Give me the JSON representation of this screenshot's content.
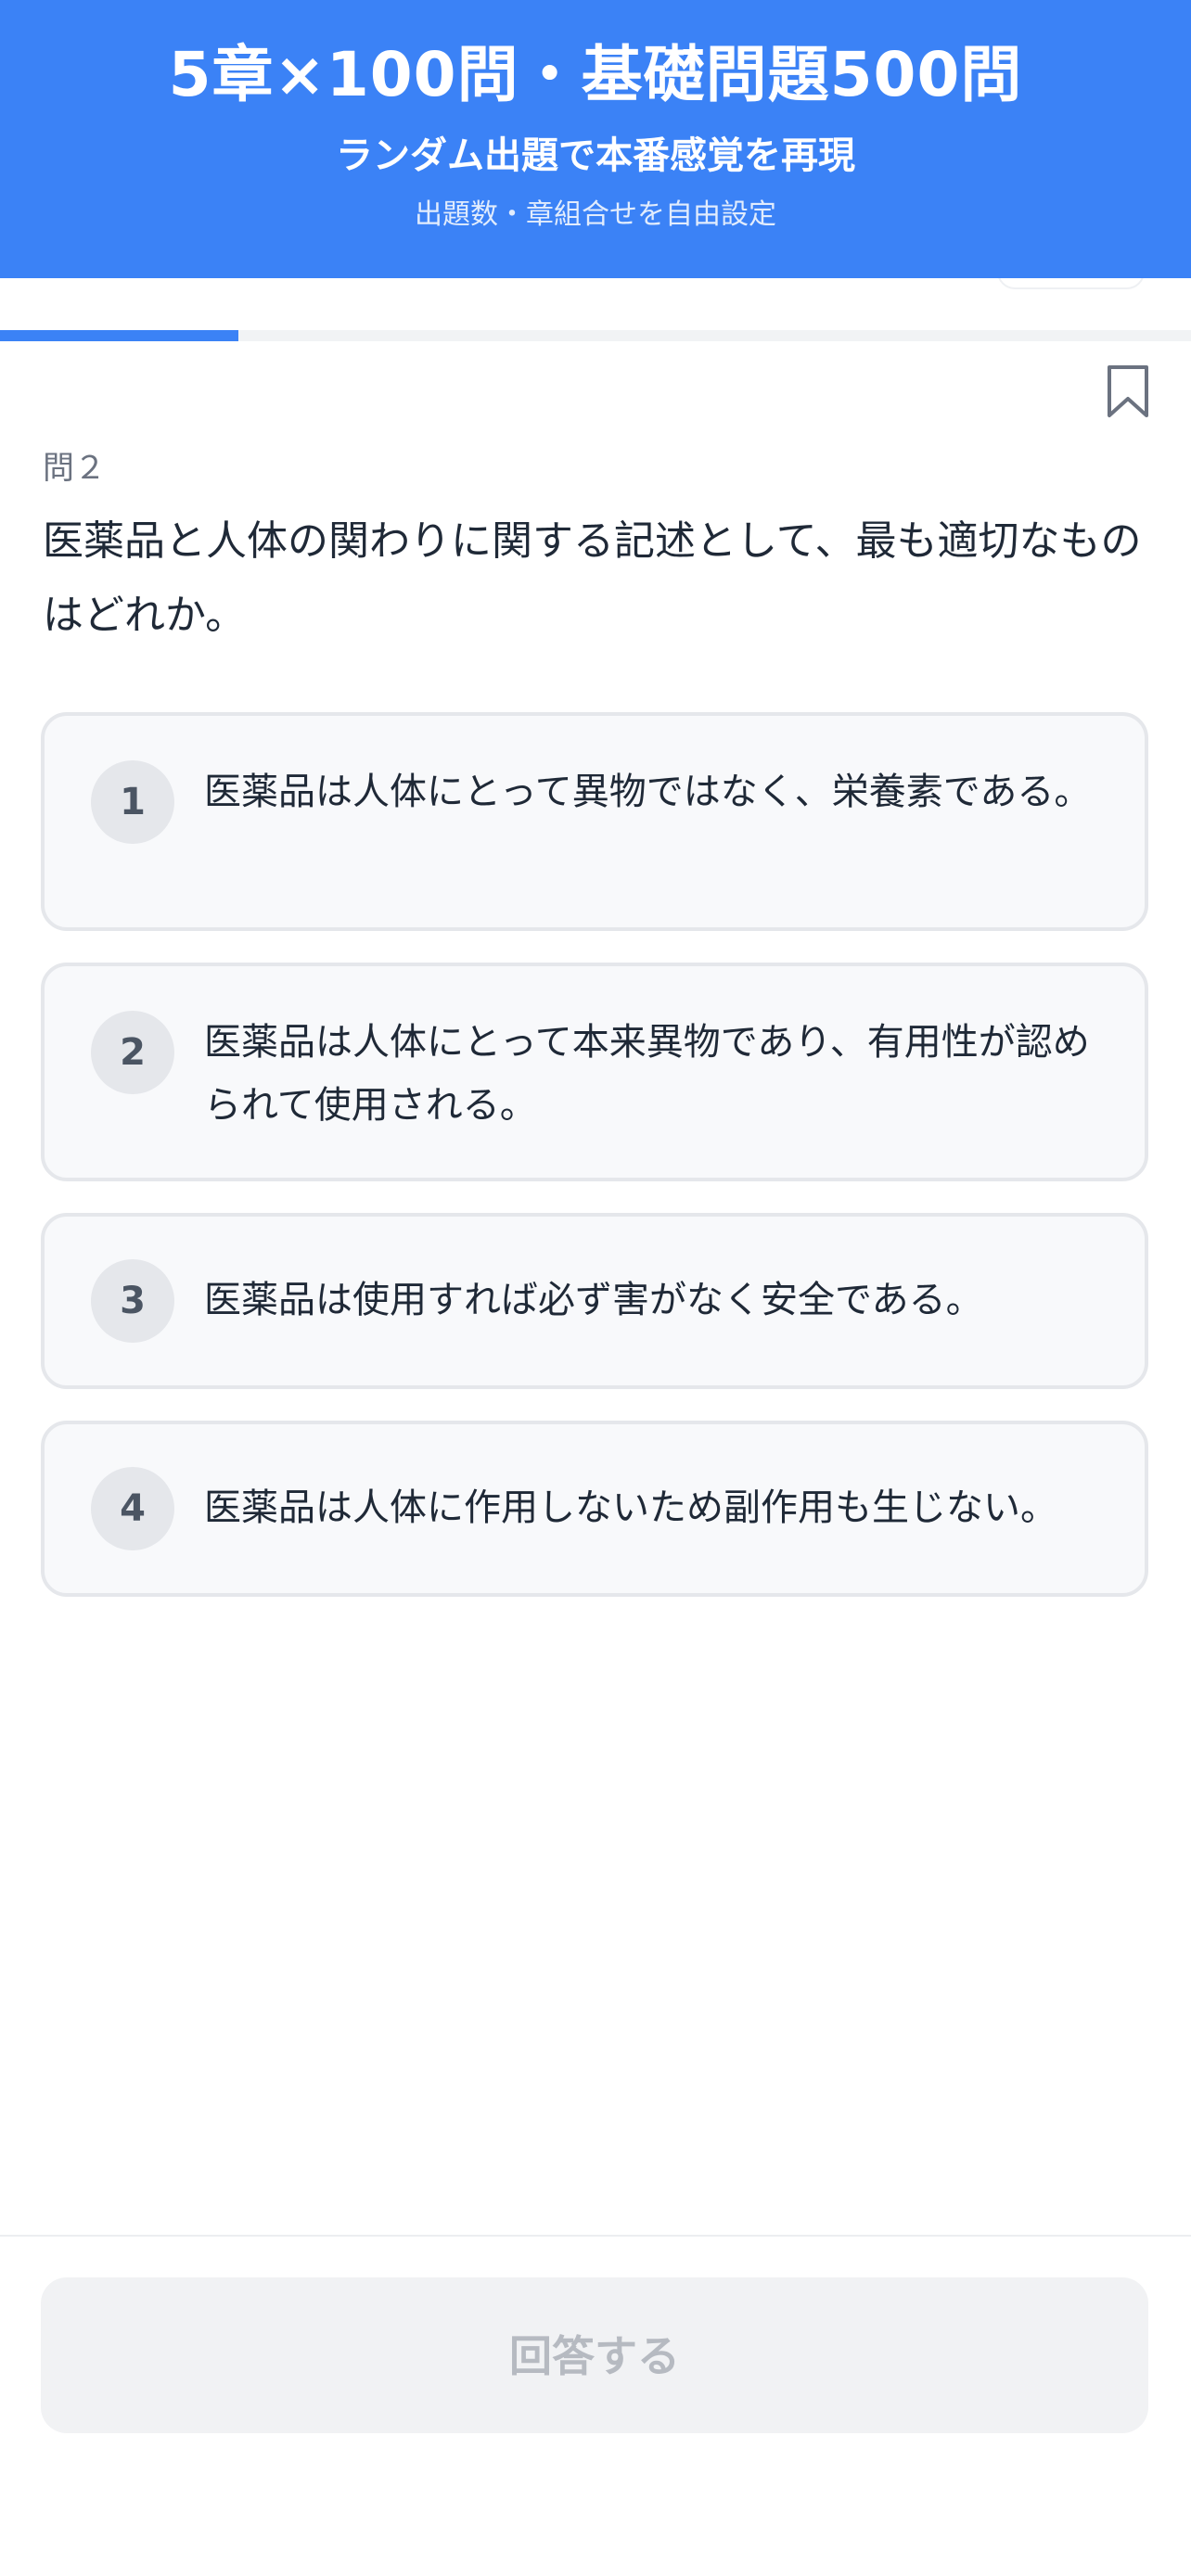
{
  "banner": {
    "title": "5章×100問・基礎問題500問",
    "subtitle": "ランダム出題で本番感覚を再現",
    "note": "出題数・章組合せを自由設定"
  },
  "progress": {
    "fraction": 0.2
  },
  "question": {
    "number_label": "問２",
    "text": "医薬品と人体の関わりに関する記述として、最も適切なものはどれか。"
  },
  "options": [
    {
      "number": "1",
      "text": "医薬品は人体にとって異物ではなく、栄養素である。"
    },
    {
      "number": "2",
      "text": "医薬品は人体にとって本来異物であり、有用性が認められて使用される。"
    },
    {
      "number": "3",
      "text": "医薬品は使用すれば必ず害がなく安全である。"
    },
    {
      "number": "4",
      "text": "医薬品は人体に作用しないため副作用も生じない。"
    }
  ],
  "footer": {
    "answer_label": "回答する"
  },
  "icons": {
    "bookmark": "bookmark-icon"
  },
  "colors": {
    "accent": "#3b82f6",
    "disabled_button_bg": "#f1f2f4",
    "disabled_button_text": "#b6bac1"
  }
}
